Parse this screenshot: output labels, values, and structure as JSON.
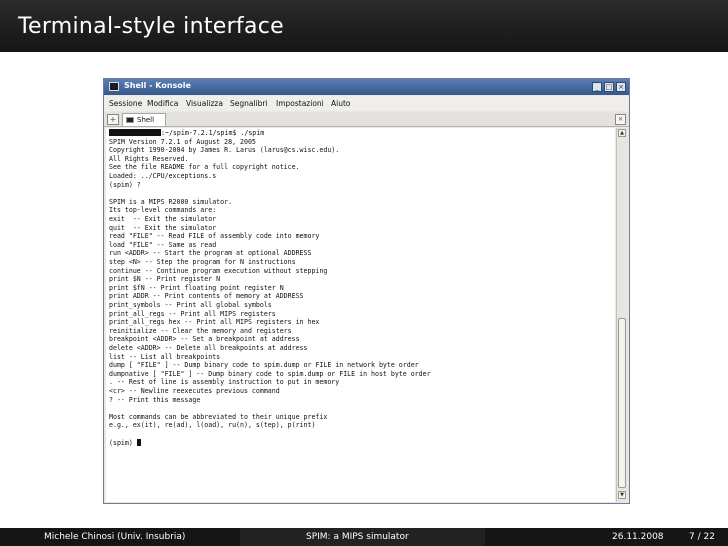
{
  "slide": {
    "title": "Terminal-style interface"
  },
  "window": {
    "title": "Shell - Konsole",
    "buttons": {
      "minimize": "_",
      "maximize": "□",
      "close": "×"
    }
  },
  "menu": [
    "Sessione",
    "Modifica",
    "Visualizza",
    "Segnalibri",
    "Impostazioni",
    "Aiuto"
  ],
  "tab": {
    "label": "Shell"
  },
  "terminal": {
    "prompt_host": ":~/spim-7.2.1/spim$ ./spim",
    "lines": [
      "SPIM Version 7.2.1 of August 28, 2005",
      "Copyright 1990-2004 by James R. Larus (larus@cs.wisc.edu).",
      "All Rights Reserved.",
      "See the file README for a full copyright notice.",
      "Loaded: ../CPU/exceptions.s",
      "(spim) ?",
      "",
      "SPIM is a MIPS R2000 simulator.",
      "Its top-level commands are:",
      "exit  -- Exit the simulator",
      "quit  -- Exit the simulator",
      "read \"FILE\" -- Read FILE of assembly code into memory",
      "load \"FILE\" -- Same as read",
      "run <ADDR> -- Start the program at optional ADDRESS",
      "step <N> -- Step the program for N instructions",
      "continue -- Continue program execution without stepping",
      "print $N -- Print register N",
      "print $fN -- Print floating point register N",
      "print ADDR -- Print contents of memory at ADDRESS",
      "print_symbols -- Print all global symbols",
      "print_all_regs -- Print all MIPS registers",
      "print_all_regs hex -- Print all MIPS registers in hex",
      "reinitialize -- Clear the memory and registers",
      "breakpoint <ADDR> -- Set a breakpoint at address",
      "delete <ADDR> -- Delete all breakpoints at address",
      "list -- List all breakpoints",
      "dump [ \"FILE\" ] -- Dump binary code to spim.dump or FILE in network byte order",
      "dumpnative [ \"FILE\" ] -- Dump binary code to spim.dump or FILE in host byte order",
      ". -- Rest of line is assembly instruction to put in memory",
      "<cr> -- Newline reexecutes previous command",
      "? -- Print this message",
      "",
      "Most commands can be abbreviated to their unique prefix",
      "e.g., ex(it), re(ad), l(oad), ru(n), s(tep), p(rint)",
      ""
    ],
    "final_prompt": "(spim) "
  },
  "footer": {
    "author": "Michele Chinosi  (Univ. Insubria)",
    "talk": "SPIM: a MIPS simulator",
    "date": "26.11.2008",
    "page": "7 / 22"
  }
}
